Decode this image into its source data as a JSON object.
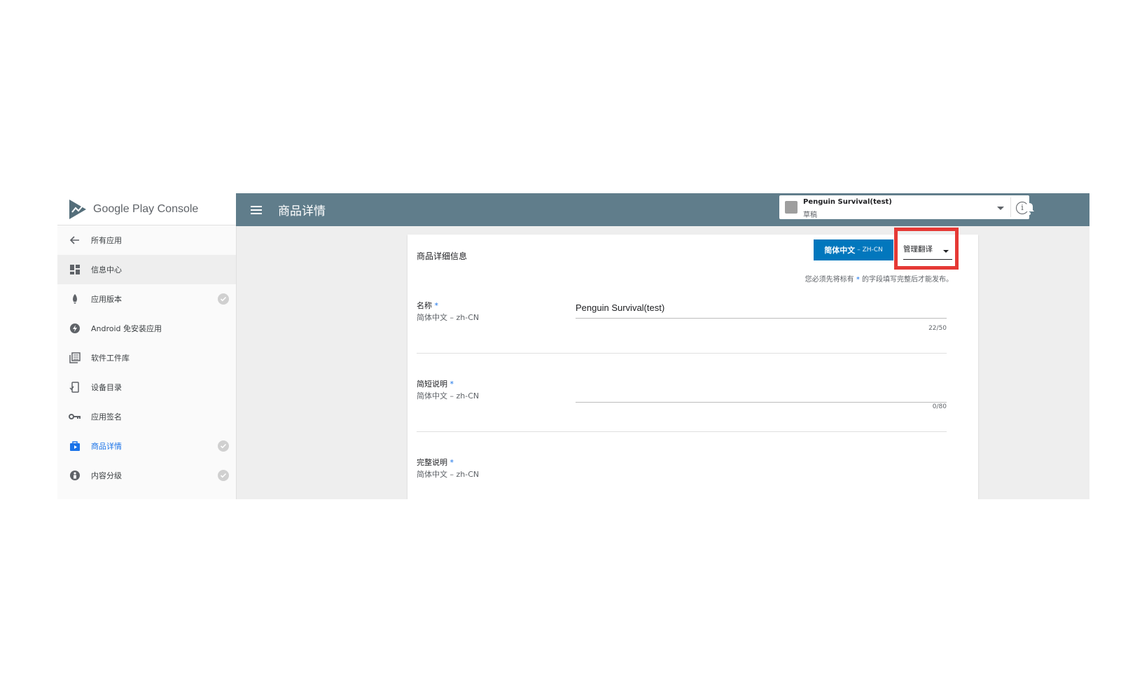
{
  "brand": {
    "name": "Google Play",
    "suffix": "Console"
  },
  "sidebar": {
    "items": [
      {
        "label": "所有应用",
        "icon": "arrow-back-icon",
        "checked": false
      },
      {
        "label": "信息中心",
        "icon": "dashboard-icon",
        "checked": false
      },
      {
        "label": "应用版本",
        "icon": "rocket-icon",
        "checked": true
      },
      {
        "label": "Android 免安装应用",
        "icon": "instant-app-icon",
        "checked": false
      },
      {
        "label": "软件工件库",
        "icon": "library-icon",
        "checked": false
      },
      {
        "label": "设备目录",
        "icon": "device-catalog-icon",
        "checked": false
      },
      {
        "label": "应用签名",
        "icon": "key-icon",
        "checked": false
      },
      {
        "label": "商品详情",
        "icon": "store-listing-icon",
        "checked": true
      },
      {
        "label": "内容分级",
        "icon": "content-rating-icon",
        "checked": true
      }
    ]
  },
  "header": {
    "title": "商品详情",
    "app": {
      "name": "Penguin Survival(test)",
      "status": "草稿"
    }
  },
  "card": {
    "title": "商品详细信息",
    "language_button": {
      "label": "简体中文",
      "code": "– ZH-CN"
    },
    "manage_translations": "管理翻译",
    "notice": {
      "before": "您必须先将标有",
      "star": "*",
      "after": "的字段填写完整后才能发布。"
    },
    "fields": [
      {
        "label": "名称",
        "required": "*",
        "locale": "简体中文 – zh-CN",
        "value": "Penguin Survival(test)",
        "counter": "22/50"
      },
      {
        "label": "简短说明",
        "required": "*",
        "locale": "简体中文 – zh-CN",
        "value": "",
        "counter": "0/80"
      },
      {
        "label": "完整说明",
        "required": "*",
        "locale": "简体中文 – zh-CN",
        "value": "",
        "counter": ""
      }
    ]
  },
  "colors": {
    "topbar": "#607d8b",
    "accent": "#0277bd",
    "highlight": "#e53935",
    "active_nav": "#1a73e8"
  }
}
